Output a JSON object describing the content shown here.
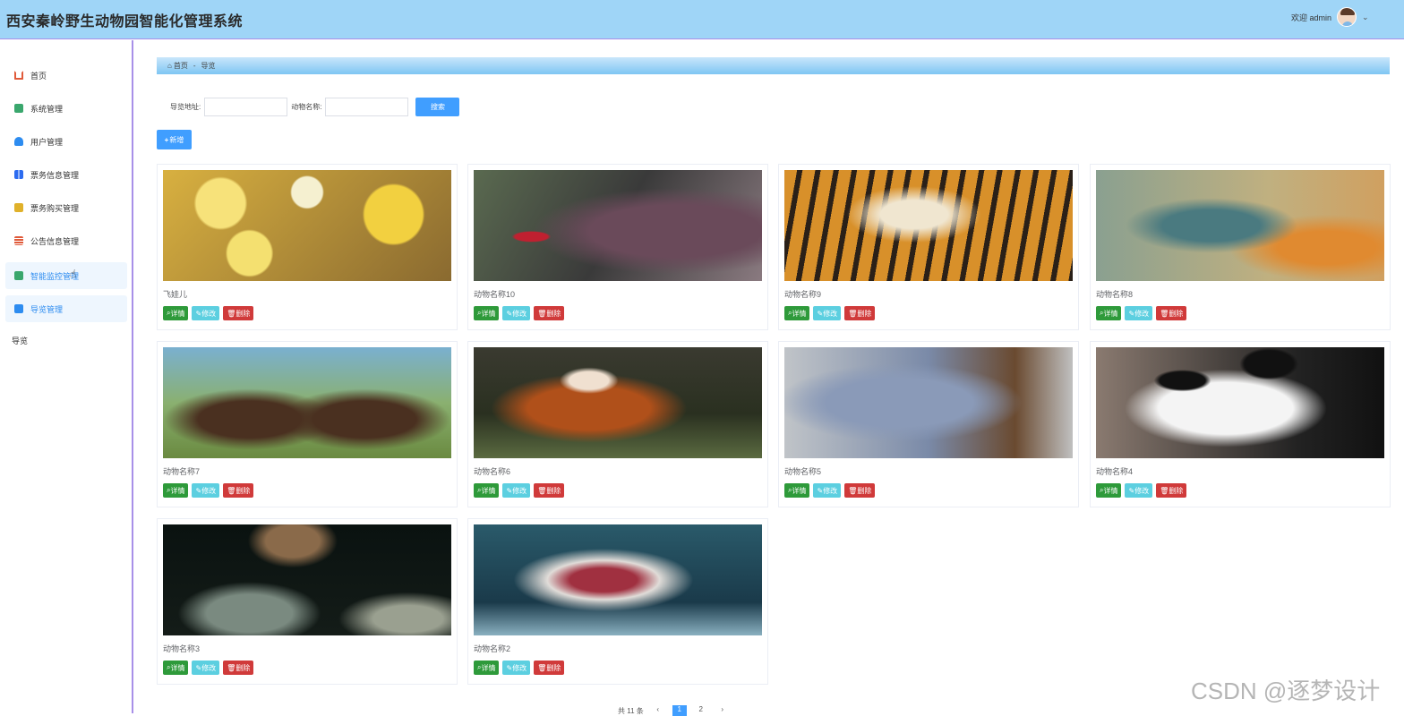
{
  "header": {
    "title": "西安秦岭野生动物园智能化管理系统",
    "welcome": "欢迎 admin"
  },
  "sidebar": {
    "items": [
      {
        "label": "首页",
        "icon": "home-icon",
        "color": "#e05a3a"
      },
      {
        "label": "系统管理",
        "icon": "box-icon",
        "color": "#3aa76d"
      },
      {
        "label": "用户管理",
        "icon": "user-icon",
        "color": "#2d8cf0"
      },
      {
        "label": "票务信息管理",
        "icon": "grid-icon",
        "color": "#2d6cf0"
      },
      {
        "label": "票务购买管理",
        "icon": "folder-icon",
        "color": "#e0b12a"
      },
      {
        "label": "公告信息管理",
        "icon": "list-icon",
        "color": "#e05a3a"
      },
      {
        "label": "智能监控管理",
        "icon": "monitor-icon",
        "color": "#3aa76d"
      },
      {
        "label": "导览管理",
        "icon": "book-icon",
        "color": "#2d8cf0"
      }
    ],
    "plain_item": "导览"
  },
  "breadcrumb": {
    "home": "首页",
    "current": "导览"
  },
  "search": {
    "field1_label": "导览地址:",
    "field2_label": "动物名称:",
    "button": "搜索"
  },
  "add_button": "新增",
  "actions": {
    "detail": "详情",
    "edit": "修改",
    "delete": "删除"
  },
  "cards": [
    {
      "name": "飞娃儿"
    },
    {
      "name": "动物名称10"
    },
    {
      "name": "动物名称9"
    },
    {
      "name": "动物名称8"
    },
    {
      "name": "动物名称7"
    },
    {
      "name": "动物名称6"
    },
    {
      "name": "动物名称5"
    },
    {
      "name": "动物名称4"
    },
    {
      "name": "动物名称3"
    },
    {
      "name": "动物名称2"
    }
  ],
  "pagination": {
    "total": "共 11 条",
    "current_page": "1",
    "next_page": "2"
  },
  "watermark": "CSDN @逐梦设计"
}
